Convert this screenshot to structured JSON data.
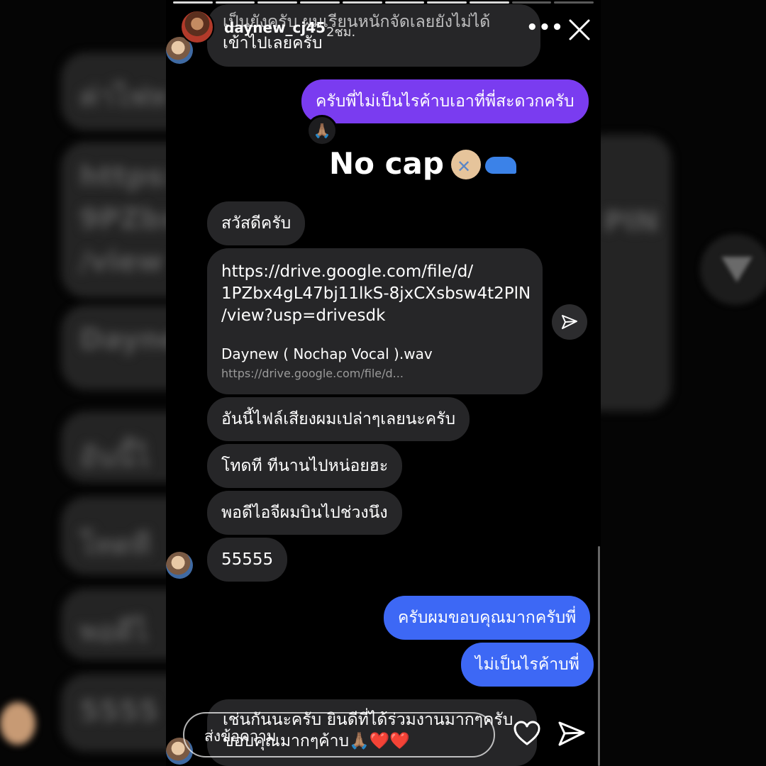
{
  "story": {
    "username": "daynew_cj45",
    "time": "2ชม.",
    "more_label": "•••",
    "reaction_emoji": "🙏🏽",
    "sticker_text": "No cap",
    "reply_placeholder": "ส่งข้อความ"
  },
  "messages": {
    "top_partial_line1": "เป็นยังครับ ผมเรียนหนักจัดเลยยังไม่ได้",
    "top_partial_line2": "เข้าไปเลยครับ",
    "out_purple": "ครับพี่ไม่เป็นไรค้าบเอาที่พี่สะดวกครับ",
    "hello": "สวัสดีครับ",
    "link_url": "https://drive.google.com/file/d/\n1PZbx4gL47bj11lkS-8jxCXsbsw4t2PlN\n/view?usp=drivesdk",
    "link_title": "Daynew ( Nochap Vocal ).wav",
    "link_domain": "https://drive.google.com/file/d...",
    "msg_file": "อันนี้ไฟล์เสียงผมเปล่าๆเลยนะครับ",
    "msg_sorry": "โทดที ทีนานไปหน่อยฮะ",
    "msg_fly": "พอดีไอจีผมบินไปช่วงนึง",
    "msg_laugh": "55555",
    "out_thanks": "ครับผมขอบคุณมากครับพี่",
    "out_nevermind": "ไม่เป็นไรค้าบพี่",
    "bottom_line1": "เช่นกันนะครับ ยินดีที่ได้ร่วมงานมากๆครับ",
    "bottom_line2": "ขอบคุณมากๆค้าบ🙏🏽",
    "bottom_hearts": "❤️❤️"
  },
  "backdrop": {
    "left_fragments": [
      "ค่าไฟห",
      "https:",
      "9PZbx",
      "/view",
      "Dayne",
      "อันนี้ไ",
      "โทดที",
      "พอดีไ",
      "5555"
    ],
    "right_fragments": [
      "PIN"
    ]
  },
  "colors": {
    "purple_bubble": "#7a3cf0",
    "blue_bubble": "#3d68f5",
    "incoming_bubble": "#262628",
    "heart_red": "#e0162b"
  },
  "icons": [
    "close-icon",
    "heart-icon",
    "send-icon",
    "share-icon",
    "more-icon"
  ]
}
